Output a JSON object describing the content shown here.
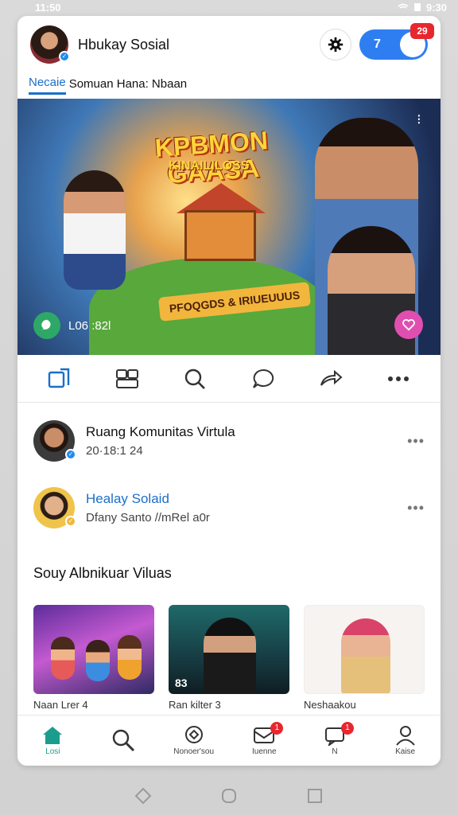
{
  "status_bar": {
    "time": "11:50",
    "indicators": "9:30"
  },
  "header": {
    "title": "Hbukay Sosial",
    "toggle_value": "7",
    "notification_count": "29"
  },
  "tabs": [
    {
      "label": "Necaie"
    },
    {
      "label": "Somuan Hana: Nbaan"
    }
  ],
  "hero": {
    "title": "KPBMON GAASA",
    "subtitle": "KINAILILOSS",
    "banner": "PFOQGDS & IRIUEUUUS",
    "live_label": "L06 :82l"
  },
  "actions": [
    {
      "icon": "edit-icon"
    },
    {
      "icon": "gallery-icon"
    },
    {
      "icon": "search-icon"
    },
    {
      "icon": "comment-icon"
    },
    {
      "icon": "share-icon"
    },
    {
      "icon": "more-icon"
    }
  ],
  "feed": [
    {
      "name": "Ruang Komunitas Virtula",
      "meta": "20·18:1 24",
      "more": "•••"
    },
    {
      "name": "Healay Solaid",
      "meta": "Dfany Santo //mRel a0r",
      "more": "•••",
      "accent": "#1a6fc9"
    }
  ],
  "section": {
    "title": "Souy Albnikuar Viluas"
  },
  "thumbnails": [
    {
      "label": "Naan Lrer 4",
      "count": ""
    },
    {
      "label": "Ran kilter 3",
      "count": "83"
    },
    {
      "label": "Neshaakou",
      "count": ""
    }
  ],
  "bottom_nav": [
    {
      "label": "Losi",
      "icon": "home-icon",
      "active": true
    },
    {
      "label": "",
      "icon": "search-icon"
    },
    {
      "label": "Nonoer'sou",
      "icon": "compass-icon"
    },
    {
      "label": "Iuenne",
      "icon": "inbox-icon",
      "badge": "1"
    },
    {
      "label": "N",
      "icon": "chat-icon",
      "badge": "1"
    },
    {
      "label": "Kaise",
      "icon": "profile-icon"
    }
  ],
  "colors": {
    "accent": "#1a6fc9",
    "active_nav": "#1a9d8c",
    "badge": "#e8262e"
  }
}
